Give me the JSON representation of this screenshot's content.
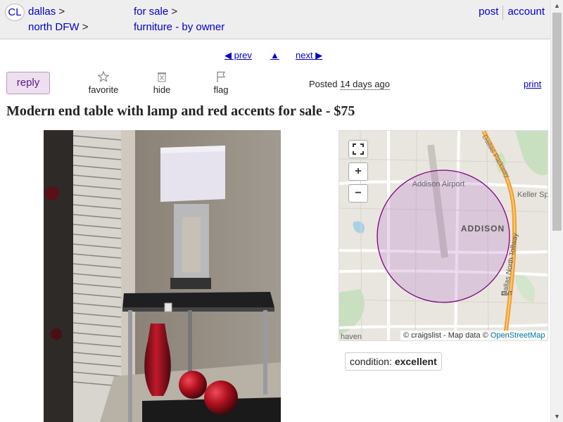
{
  "header": {
    "logo": "CL",
    "breadcrumbs": {
      "city": "dallas",
      "subarea": "north DFW",
      "category": "for sale",
      "subcategory": "furniture - by owner",
      "separator": ">"
    },
    "post_label": "post",
    "account_label": "account"
  },
  "nav": {
    "prev_label": "◀ prev",
    "up_label": "▲",
    "next_label": "next ▶"
  },
  "actions": {
    "reply_label": "reply",
    "favorite_label": "favorite",
    "hide_label": "hide",
    "flag_label": "flag",
    "posted_prefix": "Posted",
    "posted_when": "14 days ago",
    "print_label": "print"
  },
  "posting": {
    "title": "Modern end table with lamp and red accents for sale - $75"
  },
  "map": {
    "labels": {
      "airport": "Addison Airport",
      "city": "ADDISON",
      "keller": "Keller Sp",
      "haven": "haven",
      "dnt": "DNT",
      "tollway": "Dallas North Tollway",
      "parkway": "Dallas Parkway"
    },
    "controls": {
      "fullscreen": "fullscreen-icon",
      "zoom_in": "+",
      "zoom_out": "−"
    },
    "attribution_prefix": "© craigslist - Map data ©",
    "attribution_osm": "OpenStreetMap"
  },
  "attributes": {
    "condition_label": "condition:",
    "condition_value": "excellent"
  },
  "colors": {
    "link": "#0000cc",
    "reply_bg": "#eedfee",
    "map_circle": "#800080"
  }
}
